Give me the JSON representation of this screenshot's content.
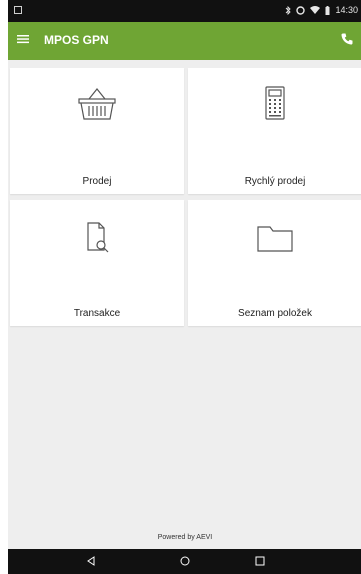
{
  "status_bar": {
    "time": "14:30",
    "icons": [
      "notification-icon",
      "bluetooth-icon",
      "alarm-icon",
      "wifi-icon",
      "battery-icon"
    ]
  },
  "app_bar": {
    "title": "MPOS GPN",
    "menu_icon": "hamburger-menu-icon",
    "action_icon": "phone-icon",
    "color": "#6fa534"
  },
  "tiles": [
    {
      "label": "Prodej",
      "icon": "basket-icon"
    },
    {
      "label": "Rychlý prodej",
      "icon": "calculator-icon"
    },
    {
      "label": "Transakce",
      "icon": "document-search-icon"
    },
    {
      "label": "Seznam položek",
      "icon": "folder-icon"
    }
  ],
  "footer": {
    "text": "Powered by AEVI"
  },
  "nav_bar": {
    "icons": [
      "back-icon",
      "home-icon",
      "recents-icon"
    ]
  }
}
